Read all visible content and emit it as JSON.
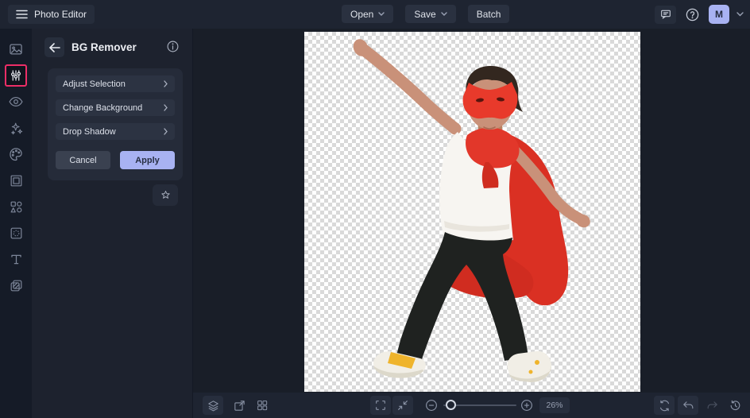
{
  "topbar": {
    "app_title": "Photo Editor",
    "open_label": "Open",
    "save_label": "Save",
    "batch_label": "Batch",
    "avatar_initial": "M"
  },
  "sidebar": {
    "items": [
      "image",
      "adjustments",
      "eye",
      "effects",
      "artsy",
      "frames",
      "graphics",
      "overlays",
      "text",
      "templates"
    ],
    "active_item": "adjustments",
    "accent_color": "#ed2e67"
  },
  "panel": {
    "title": "BG Remover",
    "rows": [
      {
        "label": "Adjust Selection"
      },
      {
        "label": "Change Background"
      },
      {
        "label": "Drop Shadow"
      }
    ],
    "cancel_label": "Cancel",
    "apply_label": "Apply"
  },
  "canvas": {
    "content": "Boy in superhero costume (red eye mask, red cape, white tank top, black pants, yellow sneakers) with fist raised, background removed to transparency checkerboard"
  },
  "bottombar": {
    "zoom_value": "26%"
  },
  "colors": {
    "accent_pink": "#ed2e67",
    "apply_button": "#a8b2f2",
    "avatar_bg": "#a8b2f2",
    "mask_red": "#e83a2b",
    "cape_red": "#da3023",
    "topbar_bg": "#1e2431"
  }
}
